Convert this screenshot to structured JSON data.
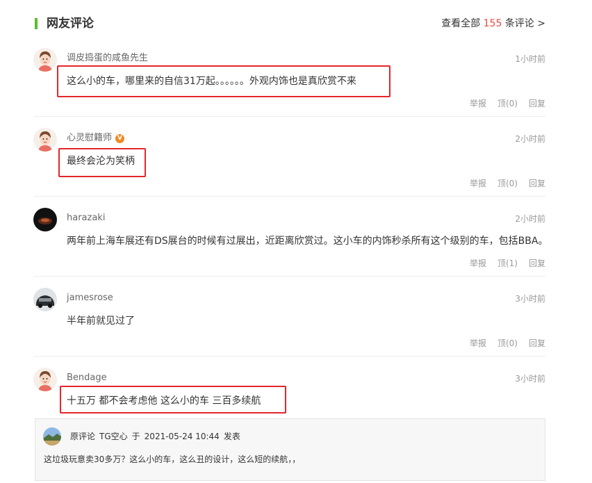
{
  "header": {
    "title": "网友评论",
    "view_all_prefix": "查看全部",
    "comment_count": "155",
    "view_all_suffix": "条评论 >",
    "accent_color": "#5bbd2b",
    "count_color": "#e84a3f"
  },
  "comments": [
    {
      "username": "调皮捣蛋的咸鱼先生",
      "time": "1小时前",
      "text": "这么小的车，哪里来的自信31万起。。。。。。外观内饰也是真欣赏不来",
      "report": "举报",
      "like": "顶(0)",
      "reply": "回复",
      "avatar": "cartoon-boy-avatar"
    },
    {
      "username": "心灵慰籍师",
      "verified_badge": "V",
      "time": "2小时前",
      "text": "最终会沦为笑柄",
      "report": "举报",
      "like": "顶(0)",
      "reply": "回复",
      "avatar": "cartoon-boy-avatar"
    },
    {
      "username": "harazaki",
      "time": "2小时前",
      "text": "两年前上海车展还有DS展台的时候有过展出，近距离欣赏过。这小车的内饰秒杀所有这个级别的车，包括BBA。",
      "report": "举报",
      "like": "顶(1)",
      "reply": "回复",
      "avatar": "dark-photo-avatar"
    },
    {
      "username": "jamesrose",
      "time": "3小时前",
      "text": "半年前就见过了",
      "report": "举报",
      "like": "顶(0)",
      "reply": "回复",
      "avatar": "car-photo-avatar"
    },
    {
      "username": "Bendage",
      "time": "3小时前",
      "text": "十五万 都不会考虑他 这么小的车 三百多续航",
      "avatar": "cartoon-boy-avatar"
    }
  ],
  "quote": {
    "label": "原评论",
    "username": "TG空心",
    "prefix": "于",
    "datetime": "2021-05-24 10:44",
    "suffix": "发表",
    "text": "这垃圾玩意卖30多万？这么小的车，这么丑的设计，这么短的续航，，",
    "avatar": "landscape-avatar"
  },
  "highlight_color": "#e3262b"
}
